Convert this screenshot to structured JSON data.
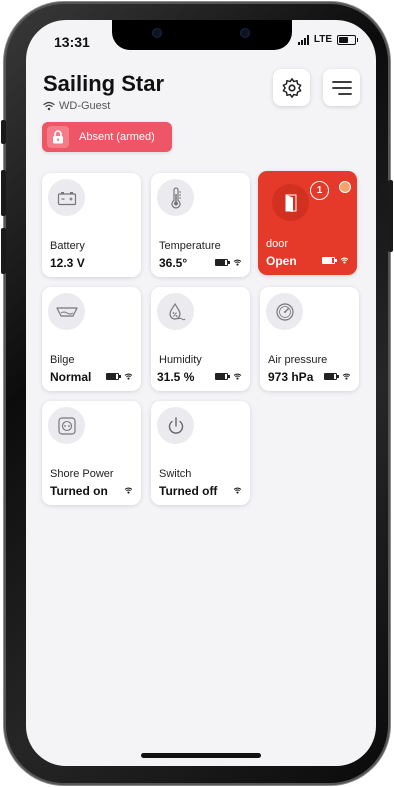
{
  "status_bar": {
    "time": "13:31",
    "network": "LTE",
    "battery_level": 0.7
  },
  "header": {
    "title": "Sailing Star",
    "wifi_name": "WD-Guest"
  },
  "icons": {
    "settings": "gear-icon",
    "menu": "hamburger-menu-icon"
  },
  "mode_badge": {
    "label": "Absent (armed)",
    "icon": "lock-icon",
    "color": "#ee5566"
  },
  "tiles": [
    {
      "icon": "battery-icon",
      "label": "Battery",
      "value": "12.3 V",
      "show_battery": false,
      "show_wifi": false
    },
    {
      "icon": "thermometer-icon",
      "label": "Temperature",
      "value": "36.5°",
      "show_battery": true,
      "battery_level": 0.8,
      "show_wifi": true
    },
    {
      "icon": "door-icon",
      "label": "door",
      "value": "Open",
      "alert": true,
      "alert_count": "1",
      "alert_color": "#e53a2a",
      "show_battery": true,
      "battery_level": 0.8,
      "show_wifi": true
    },
    {
      "icon": "bilge-icon",
      "label": "Bilge",
      "value": "Normal",
      "show_battery": true,
      "battery_level": 0.8,
      "show_wifi": true
    },
    {
      "icon": "humidity-icon",
      "label": "Humidity",
      "value": "31.5 %",
      "show_battery": true,
      "battery_level": 0.8,
      "show_wifi": true
    },
    {
      "icon": "gauge-icon",
      "label": "Air pressure",
      "value": "973 hPa",
      "show_battery": true,
      "battery_level": 0.8,
      "show_wifi": true
    },
    {
      "icon": "power-outlet-icon",
      "label": "Shore Power",
      "value": "Turned on",
      "show_battery": false,
      "show_wifi": true
    },
    {
      "icon": "power-icon",
      "label": "Switch",
      "value": "Turned off",
      "show_battery": false,
      "show_wifi": true
    }
  ]
}
